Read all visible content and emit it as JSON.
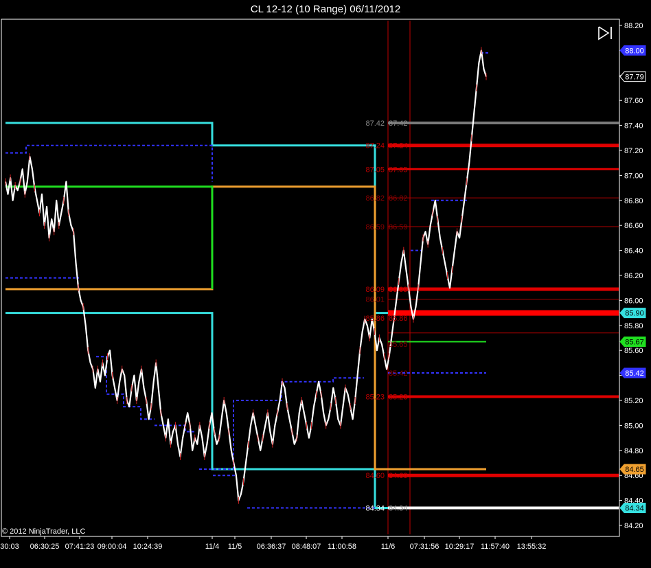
{
  "title": "CL 12-12 (10 Range)  06/11/2012",
  "copyright": "© 2012 NinjaTrader, LLC",
  "icons": {
    "play_end": "skip-to-end-icon"
  },
  "colors": {
    "background": "#000000",
    "cyan": "#36e0e0",
    "orange": "#f0a030",
    "green": "#20e020",
    "red": "#e00000",
    "darkred": "#b00000",
    "blue": "#3333ff",
    "white": "#ffffff",
    "gray": "#7a7a7a",
    "price": "#ffffff"
  },
  "chart_data": {
    "type": "line",
    "title": "CL 12-12 (10 Range)  06/11/2012",
    "ylim": [
      84.15,
      88.25
    ],
    "y_ticks": [
      "88.20",
      "88.00",
      "87.80",
      "87.60",
      "87.40",
      "87.20",
      "87.00",
      "86.80",
      "86.60",
      "86.40",
      "86.20",
      "86.00",
      "85.80",
      "85.60",
      "85.40",
      "85.20",
      "85.00",
      "84.80",
      "84.60",
      "84.40",
      "84.20"
    ],
    "x_tick_labels": [
      "30:03",
      "06:30:25",
      "07:41:23",
      "09:00:04",
      "10:24:39",
      "11/4",
      "11/5",
      "06:36:37",
      "08:48:07",
      "11:00:58",
      "11/6",
      "07:31:56",
      "10:29:17",
      "11:57:40",
      "13:55:32"
    ],
    "axis_badges": [
      {
        "value": "88.00",
        "color": "#3333ff",
        "text_color": "#ffffff"
      },
      {
        "value": "87.79",
        "color": "#000000",
        "text_color": "#ffffff"
      },
      {
        "value": "85.90",
        "color": "#36e0e0",
        "text_color": "#000000"
      },
      {
        "value": "85.67",
        "color": "#20e020",
        "text_color": "#000000"
      },
      {
        "value": "85.42",
        "color": "#3333ff",
        "text_color": "#ffffff"
      },
      {
        "value": "84.65",
        "color": "#f0a030",
        "text_color": "#000000"
      },
      {
        "value": "84.34",
        "color": "#36e0e0",
        "text_color": "#000000"
      }
    ],
    "price_series": {
      "name": "",
      "values": [
        86.95,
        86.85,
        86.98,
        86.8,
        86.92,
        86.88,
        86.95,
        87.05,
        86.85,
        86.95,
        87.15,
        87.05,
        86.9,
        86.8,
        86.7,
        86.85,
        86.6,
        86.75,
        86.5,
        86.65,
        86.55,
        86.8,
        86.6,
        86.7,
        86.8,
        86.95,
        86.7,
        86.6,
        86.55,
        86.3,
        86.1,
        86.0,
        85.95,
        85.8,
        85.6,
        85.5,
        85.45,
        85.3,
        85.45,
        85.35,
        85.5,
        85.4,
        85.55,
        85.6,
        85.4,
        85.3,
        85.2,
        85.35,
        85.45,
        85.4,
        85.2,
        85.15,
        85.3,
        85.4,
        85.2,
        85.35,
        85.45,
        85.3,
        85.2,
        85.05,
        85.15,
        85.35,
        85.5,
        85.3,
        85.1,
        85.0,
        84.9,
        85.05,
        84.85,
        84.95,
        85.0,
        84.85,
        84.75,
        84.9,
        85.0,
        85.1,
        85.0,
        84.8,
        84.9,
        84.85,
        85.0,
        84.9,
        84.75,
        84.85,
        85.0,
        85.1,
        84.95,
        84.85,
        84.9,
        85.05,
        85.2,
        85.1,
        84.95,
        84.8,
        84.7,
        84.6,
        84.4,
        84.45,
        84.55,
        84.7,
        84.85,
        85.0,
        85.1,
        85.0,
        84.9,
        84.8,
        84.9,
        85.0,
        85.1,
        84.95,
        84.85,
        85.0,
        85.1,
        85.2,
        85.35,
        85.3,
        85.15,
        85.05,
        84.95,
        84.85,
        84.9,
        85.1,
        85.2,
        85.1,
        85.0,
        84.9,
        85.0,
        85.15,
        85.25,
        85.35,
        85.25,
        85.1,
        85.0,
        85.05,
        85.15,
        85.3,
        85.2,
        85.05,
        85.0,
        85.15,
        85.3,
        85.25,
        85.15,
        85.05,
        85.2,
        85.4,
        85.6,
        85.75,
        85.85,
        85.8,
        85.7,
        85.85,
        85.75,
        85.6,
        85.7,
        85.65,
        85.55,
        85.45,
        85.55,
        85.7,
        85.85,
        86.0,
        86.15,
        86.3,
        86.4,
        86.25,
        86.1,
        85.95,
        85.85,
        85.95,
        86.1,
        86.3,
        86.5,
        86.55,
        86.45,
        86.6,
        86.7,
        86.8,
        86.65,
        86.5,
        86.4,
        86.3,
        86.2,
        86.1,
        86.25,
        86.4,
        86.55,
        86.5,
        86.65,
        86.8,
        86.95,
        87.1,
        87.3,
        87.5,
        87.7,
        87.9,
        88.0,
        87.85,
        87.79
      ]
    },
    "label_pairs_left": [
      {
        "value": "87.42",
        "color": "#8a8a8a"
      },
      {
        "value": "87.24",
        "color": "#c00000"
      },
      {
        "value": "87.05",
        "color": "#c00000"
      },
      {
        "value": "86.82",
        "color": "#900000"
      },
      {
        "value": "86.59",
        "color": "#900000"
      },
      {
        "value": "86.09",
        "color": "#c00000"
      },
      {
        "value": "86.01",
        "color": "#900000"
      },
      {
        "value": "85.86",
        "color": "#c00000"
      },
      {
        "value": "85.23",
        "color": "#c00000"
      },
      {
        "value": "84.60",
        "color": "#c00000"
      },
      {
        "value": "84.34",
        "color": "#ffffff"
      }
    ],
    "label_pairs_right": [
      {
        "value": "87.42",
        "color": "#8a8a8a"
      },
      {
        "value": "87.24",
        "color": "#c00000"
      },
      {
        "value": "87.05",
        "color": "#c00000"
      },
      {
        "value": "86.82",
        "color": "#900000"
      },
      {
        "value": "86.59",
        "color": "#900000"
      },
      {
        "value": "86.09",
        "color": "#c00000"
      },
      {
        "value": "85.86",
        "color": "#c00000"
      },
      {
        "value": "85.65",
        "color": "#900000"
      },
      {
        "value": "85.42",
        "color": "#900000"
      },
      {
        "value": "85.23",
        "color": "#c00000"
      },
      {
        "value": "84.60",
        "color": "#c00000"
      },
      {
        "value": "84.34",
        "color": "#8a8a8a"
      }
    ],
    "right_levels": [
      {
        "value": 87.42,
        "color": "#7a7a7a",
        "width": 4
      },
      {
        "value": 87.24,
        "color": "#e00000",
        "width": 5
      },
      {
        "value": 87.05,
        "color": "#e00000",
        "width": 3
      },
      {
        "value": 86.82,
        "color": "#b00000",
        "width": 1
      },
      {
        "value": 86.59,
        "color": "#b00000",
        "width": 1
      },
      {
        "value": 86.09,
        "color": "#e00000",
        "width": 5
      },
      {
        "value": 86.01,
        "color": "#b00000",
        "width": 1
      },
      {
        "value": 85.9,
        "color": "#ff0000",
        "width": 8
      },
      {
        "value": 85.74,
        "color": "#b00000",
        "width": 1
      },
      {
        "value": 85.23,
        "color": "#e00000",
        "width": 4
      },
      {
        "value": 84.6,
        "color": "#e00000",
        "width": 5
      },
      {
        "value": 84.34,
        "color": "#ffffff",
        "width": 4
      }
    ]
  }
}
